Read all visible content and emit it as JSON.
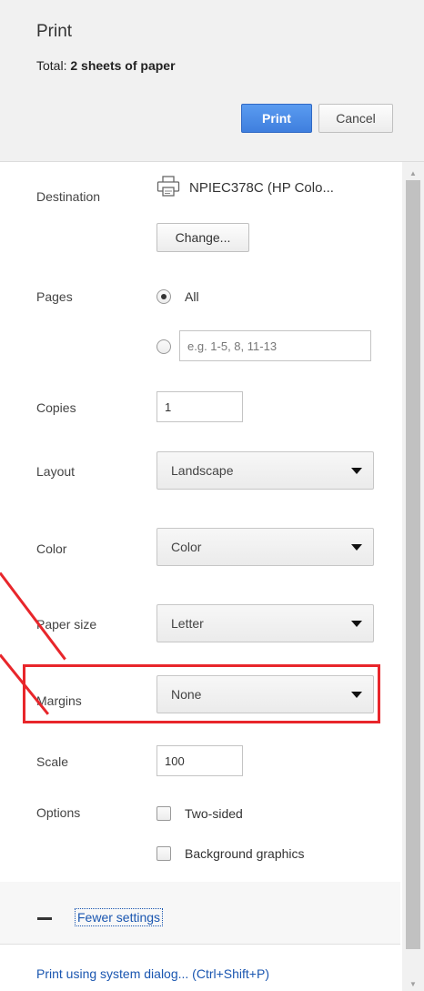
{
  "header": {
    "title": "Print",
    "total_prefix": "Total: ",
    "total_value": "2 sheets of paper",
    "print_label": "Print",
    "cancel_label": "Cancel"
  },
  "destination": {
    "label": "Destination",
    "printer_name": "NPIEC378C (HP Colo...",
    "change_label": "Change..."
  },
  "pages": {
    "label": "Pages",
    "all_label": "All",
    "custom_placeholder": "e.g. 1-5, 8, 11-13",
    "selected": "All"
  },
  "copies": {
    "label": "Copies",
    "value": "1"
  },
  "layout": {
    "label": "Layout",
    "value": "Landscape"
  },
  "color": {
    "label": "Color",
    "value": "Color"
  },
  "paper_size": {
    "label": "Paper size",
    "value": "Letter"
  },
  "margins": {
    "label": "Margins",
    "value": "None"
  },
  "scale": {
    "label": "Scale",
    "value": "100"
  },
  "options": {
    "label": "Options",
    "two_sided_label": "Two-sided",
    "two_sided_checked": false,
    "background_graphics_label": "Background graphics",
    "background_graphics_checked": false
  },
  "footer": {
    "fewer_settings_label": "Fewer settings",
    "system_dialog_label": "Print using system dialog... (Ctrl+Shift+P)"
  },
  "colors": {
    "accent": "#3f7fde",
    "link": "#1a56b0",
    "annotation": "#e8262b"
  }
}
